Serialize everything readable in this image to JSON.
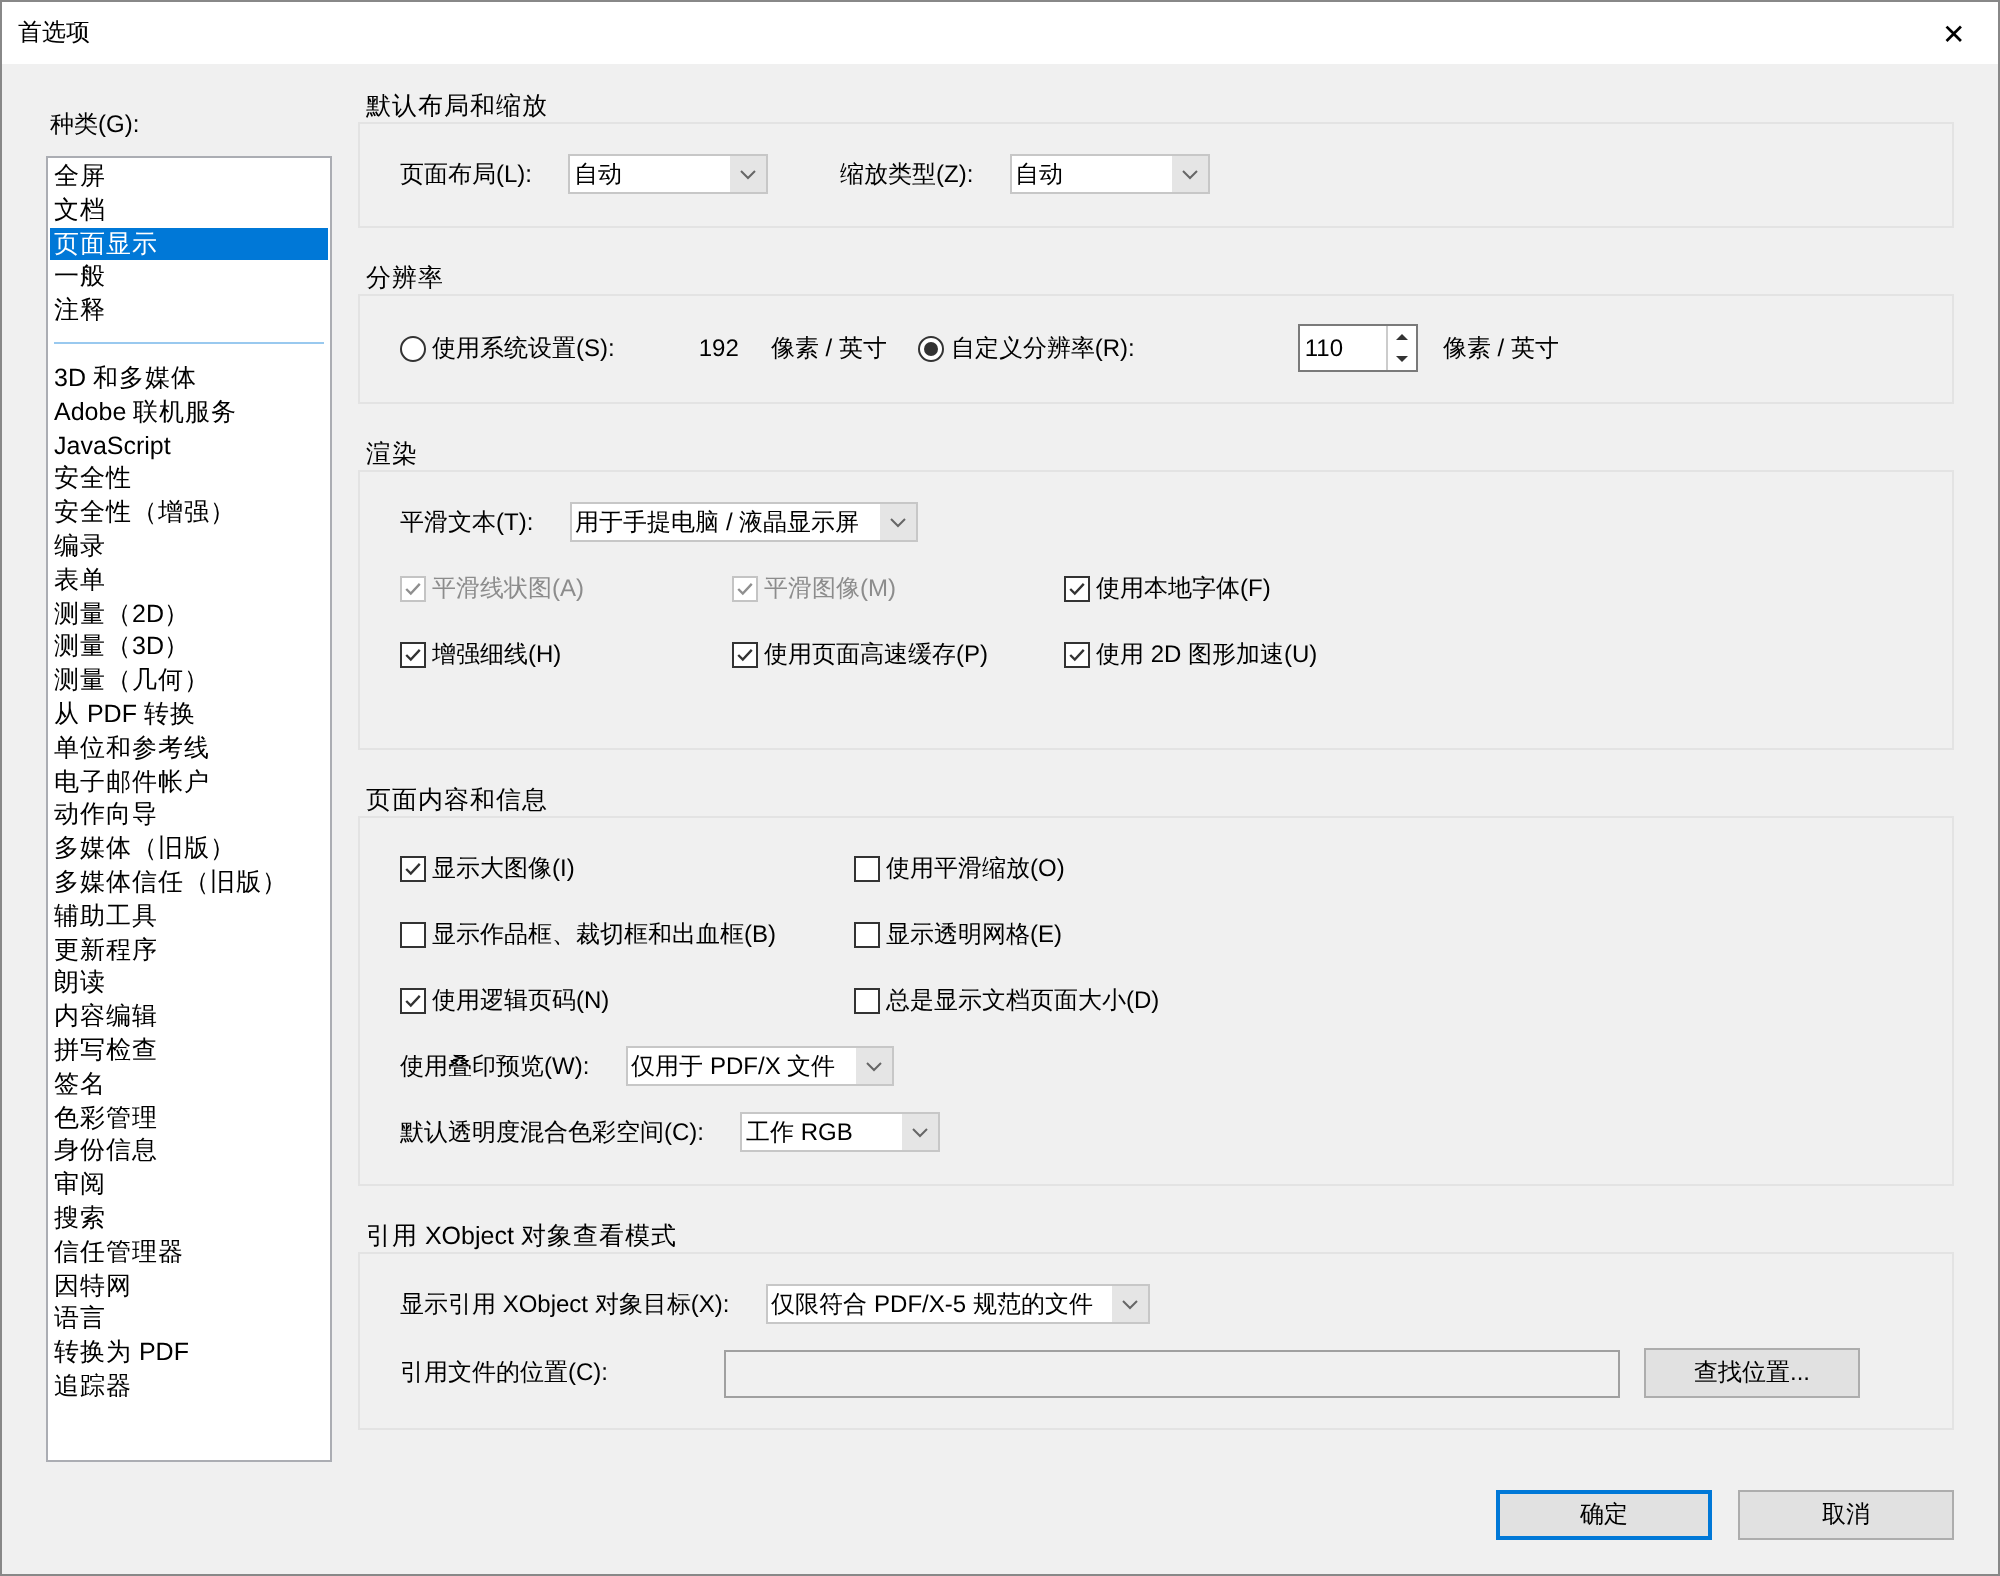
{
  "window": {
    "title": "首选项",
    "close": "✕"
  },
  "category_label": "种类(G):",
  "category_groups": [
    [
      {
        "label": "全屏",
        "selected": false
      },
      {
        "label": "文档",
        "selected": false
      },
      {
        "label": "页面显示",
        "selected": true
      },
      {
        "label": "一般",
        "selected": false
      },
      {
        "label": "注释",
        "selected": false
      }
    ],
    [
      {
        "label": "3D 和多媒体",
        "selected": false
      },
      {
        "label": "Adobe 联机服务",
        "selected": false
      },
      {
        "label": "JavaScript",
        "selected": false
      },
      {
        "label": "安全性",
        "selected": false
      },
      {
        "label": "安全性（增强）",
        "selected": false
      },
      {
        "label": "编录",
        "selected": false
      },
      {
        "label": "表单",
        "selected": false
      },
      {
        "label": "测量（2D）",
        "selected": false
      },
      {
        "label": "测量（3D）",
        "selected": false
      },
      {
        "label": "测量（几何）",
        "selected": false
      },
      {
        "label": "从 PDF 转换",
        "selected": false
      },
      {
        "label": "单位和参考线",
        "selected": false
      },
      {
        "label": "电子邮件帐户",
        "selected": false
      },
      {
        "label": "动作向导",
        "selected": false
      },
      {
        "label": "多媒体（旧版）",
        "selected": false
      },
      {
        "label": "多媒体信任（旧版）",
        "selected": false
      },
      {
        "label": "辅助工具",
        "selected": false
      },
      {
        "label": "更新程序",
        "selected": false
      },
      {
        "label": "朗读",
        "selected": false
      },
      {
        "label": "内容编辑",
        "selected": false
      },
      {
        "label": "拼写检查",
        "selected": false
      },
      {
        "label": "签名",
        "selected": false
      },
      {
        "label": "色彩管理",
        "selected": false
      },
      {
        "label": "身份信息",
        "selected": false
      },
      {
        "label": "审阅",
        "selected": false
      },
      {
        "label": "搜索",
        "selected": false
      },
      {
        "label": "信任管理器",
        "selected": false
      },
      {
        "label": "因特网",
        "selected": false
      },
      {
        "label": "语言",
        "selected": false
      },
      {
        "label": "转换为 PDF",
        "selected": false
      },
      {
        "label": "追踪器",
        "selected": false
      }
    ]
  ],
  "sections": [
    {
      "title": "默认布局和缩放",
      "rows": [
        [
          {
            "kind": "dropdown",
            "label": "页面布局(L):",
            "value": "自动"
          },
          {
            "kind": "dropdown",
            "label": "缩放类型(Z):",
            "value": "自动"
          }
        ]
      ]
    },
    {
      "title": "分辨率",
      "rows": [
        [
          {
            "kind": "radio",
            "label": "使用系统设置(S):",
            "selected": false
          },
          {
            "kind": "text",
            "text": "192"
          },
          {
            "kind": "text",
            "text": "像素 / 英寸"
          },
          {
            "kind": "radio",
            "label": "自定义分辨率(R):",
            "selected": true
          },
          {
            "kind": "spinner",
            "value": "110"
          },
          {
            "kind": "text",
            "text": "像素 / 英寸"
          }
        ]
      ]
    },
    {
      "title": "渲染",
      "rows": [
        [
          {
            "kind": "dropdown",
            "label": "平滑文本(T):",
            "value": "用于手提电脑 / 液晶显示屏"
          }
        ],
        [
          {
            "kind": "checkbox",
            "label": "平滑线状图(A)",
            "checked": true,
            "disabled": true
          },
          {
            "kind": "checkbox",
            "label": "平滑图像(M)",
            "checked": true,
            "disabled": true
          },
          {
            "kind": "checkbox",
            "label": "使用本地字体(F)",
            "checked": true,
            "disabled": false
          }
        ],
        [
          {
            "kind": "checkbox",
            "label": "增强细线(H)",
            "checked": true,
            "disabled": false
          },
          {
            "kind": "checkbox",
            "label": "使用页面高速缓存(P)",
            "checked": true,
            "disabled": false
          },
          {
            "kind": "checkbox",
            "label": "使用 2D 图形加速(U)",
            "checked": true,
            "disabled": false
          }
        ]
      ]
    },
    {
      "title": "页面内容和信息",
      "rows": [
        [
          {
            "kind": "checkbox",
            "label": "显示大图像(I)",
            "checked": true,
            "disabled": false
          },
          {
            "kind": "checkbox",
            "label": "使用平滑缩放(O)",
            "checked": false,
            "disabled": false
          }
        ],
        [
          {
            "kind": "checkbox",
            "label": "显示作品框、裁切框和出血框(B)",
            "checked": false,
            "disabled": false
          },
          {
            "kind": "checkbox",
            "label": "显示透明网格(E)",
            "checked": false,
            "disabled": false
          }
        ],
        [
          {
            "kind": "checkbox",
            "label": "使用逻辑页码(N)",
            "checked": true,
            "disabled": false
          },
          {
            "kind": "checkbox",
            "label": "总是显示文档页面大小(D)",
            "checked": false,
            "disabled": false
          }
        ],
        [
          {
            "kind": "dropdown",
            "label": "使用叠印预览(W):",
            "value": "仅用于 PDF/X 文件"
          }
        ],
        [
          {
            "kind": "dropdown",
            "label": "默认透明度混合色彩空间(C):",
            "value": "工作 RGB"
          }
        ]
      ]
    },
    {
      "title": "引用 XObject 对象查看模式",
      "rows": [
        [
          {
            "kind": "dropdown",
            "label": "显示引用 XObject 对象目标(X):",
            "value": "仅限符合 PDF/X-5 规范的文件"
          }
        ],
        [
          {
            "kind": "field",
            "label": "引用文件的位置(C):"
          },
          {
            "kind": "button",
            "label": "查找位置..."
          }
        ]
      ]
    }
  ],
  "buttons": [
    {
      "label": "确定",
      "default": true
    },
    {
      "label": "取消",
      "default": false
    }
  ]
}
